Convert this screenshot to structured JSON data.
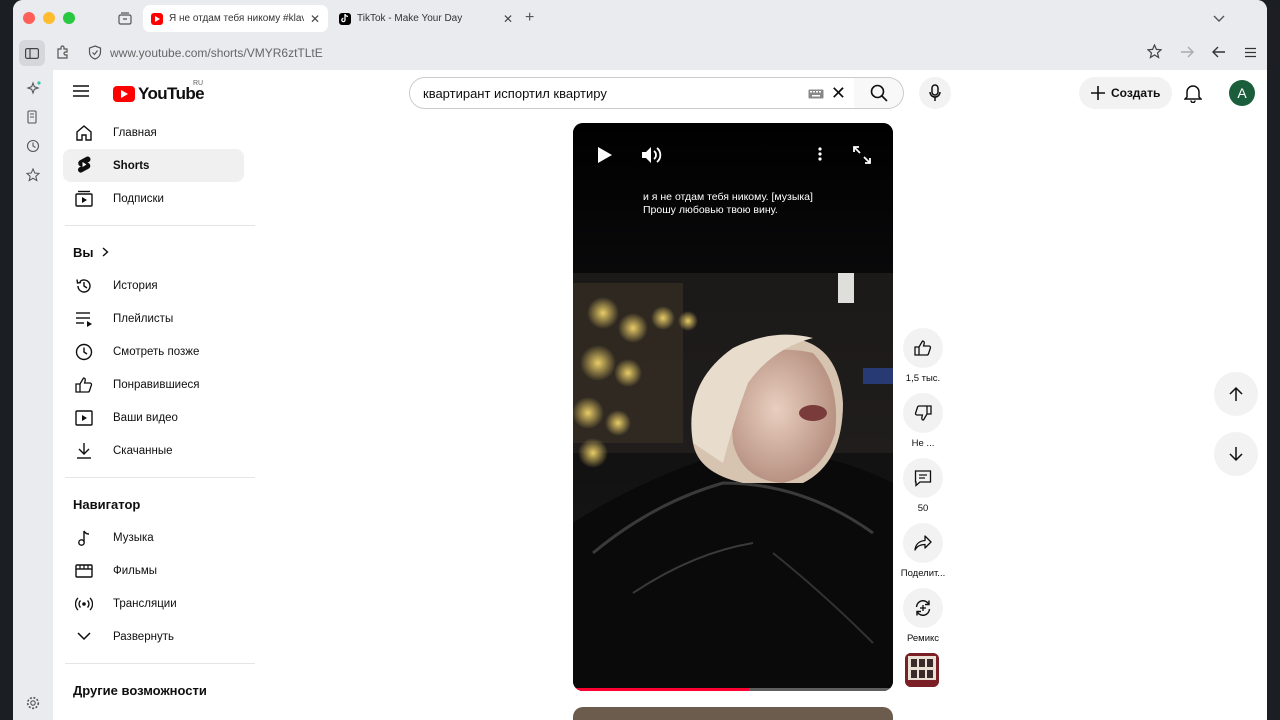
{
  "browser": {
    "tabs": [
      {
        "title": "Я не отдам тебя никому #klava",
        "active": true
      },
      {
        "title": "TikTok - Make Your Day",
        "active": false
      }
    ],
    "url": "www.youtube.com/shorts/VMYR6ztTLtE"
  },
  "youtube": {
    "logo_text": "YouTube",
    "region": "RU",
    "search_value": "квартирант испортил квартиру",
    "create_label": "Создать",
    "avatar_letter": "A",
    "accent": "#ff0000"
  },
  "guide": {
    "main": [
      {
        "label": "Главная",
        "icon": "home-icon"
      },
      {
        "label": "Shorts",
        "icon": "shorts-icon",
        "selected": true
      },
      {
        "label": "Подписки",
        "icon": "subscriptions-icon"
      }
    ],
    "you_heading": "Вы",
    "you": [
      {
        "label": "История",
        "icon": "history-icon"
      },
      {
        "label": "Плейлисты",
        "icon": "playlists-icon"
      },
      {
        "label": "Смотреть позже",
        "icon": "watch-later-icon"
      },
      {
        "label": "Понравившиеся",
        "icon": "liked-icon"
      },
      {
        "label": "Ваши видео",
        "icon": "your-videos-icon"
      },
      {
        "label": "Скачанные",
        "icon": "downloads-icon"
      }
    ],
    "navigator_heading": "Навигатор",
    "navigator": [
      {
        "label": "Музыка",
        "icon": "music-icon"
      },
      {
        "label": "Фильмы",
        "icon": "movies-icon"
      },
      {
        "label": "Трансляции",
        "icon": "live-icon"
      },
      {
        "label": "Развернуть",
        "icon": "chevron-down-icon"
      }
    ],
    "other_heading": "Другие возможности"
  },
  "short": {
    "caption_line1": "и я не отдам тебя никому. [музыка]",
    "caption_line2": "Прошу любовью твою вину.",
    "progress": 0.55
  },
  "actions": {
    "likes": "1,5 тыс.",
    "dislike": "Не ...",
    "comments": "50",
    "share": "Поделит...",
    "remix": "Ремикс"
  }
}
